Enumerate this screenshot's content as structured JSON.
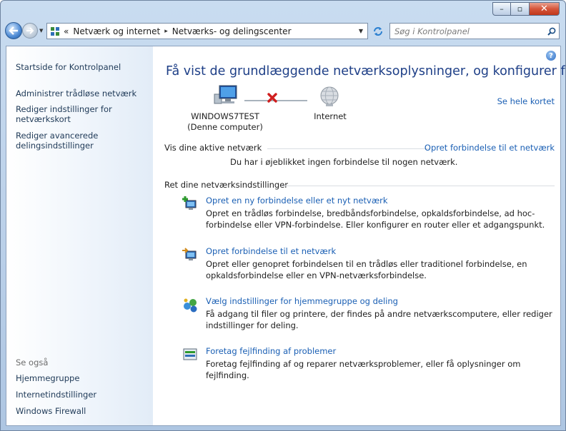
{
  "window": {
    "caption_min": "–",
    "caption_max": "▫",
    "caption_close": "✕"
  },
  "navbar": {
    "address_segments": [
      "Netværk og internet",
      "Netværks- og delingscenter"
    ],
    "address_prefix": "«",
    "address_sep": "▸",
    "search_placeholder": "Søg i Kontrolpanel"
  },
  "sidebar": {
    "top_links": [
      {
        "label": "Startside for Kontrolpanel"
      },
      {
        "label": "Administrer trådløse netværk"
      },
      {
        "label": "Rediger indstillinger for netværkskort"
      },
      {
        "label": "Rediger avancerede delingsindstillinger"
      }
    ],
    "see_also_heading": "Se også",
    "see_also": [
      {
        "label": "Hjemmegruppe"
      },
      {
        "label": "Internetindstillinger"
      },
      {
        "label": "Windows Firewall"
      }
    ]
  },
  "main": {
    "title": "Få vist de grundlæggende netværksoplysninger, og konfigurer forbindelser",
    "map_link": "Se hele kortet",
    "computer_name": "WINDOWS7TEST",
    "computer_sub": "(Denne computer)",
    "internet_label": "Internet",
    "active_heading": "Vis dine aktive netværk",
    "connect_link": "Opret forbindelse til et netværk",
    "no_connection": "Du har i øjeblikket ingen forbindelse til nogen netværk.",
    "change_heading": "Ret dine netværksindstillinger",
    "tasks": [
      {
        "title": "Opret en ny forbindelse eller et nyt netværk",
        "desc": "Opret en trådløs forbindelse, bredbåndsforbindelse, opkaldsforbindelse, ad hoc-forbindelse eller VPN-forbindelse. Eller konfigurer en router eller et adgangspunkt.",
        "icon": "new-connection-icon"
      },
      {
        "title": "Opret forbindelse til et netværk",
        "desc": "Opret eller genopret forbindelsen til en trådløs eller traditionel forbindelse, en opkaldsforbindelse eller en VPN-netværksforbindelse.",
        "icon": "connect-network-icon"
      },
      {
        "title": "Vælg indstillinger for hjemmegruppe og deling",
        "desc": "Få adgang til filer og printere, der findes på andre netværkscomputere, eller rediger indstillinger for deling.",
        "icon": "homegroup-icon"
      },
      {
        "title": "Foretag fejlfinding af problemer",
        "desc": "Foretag fejlfinding af og reparer netværksproblemer, eller få oplysninger om fejlfinding.",
        "icon": "troubleshoot-icon"
      }
    ]
  },
  "colors": {
    "link": "#1a5fb4",
    "title": "#1e3f87",
    "error_x": "#d01e1e"
  }
}
